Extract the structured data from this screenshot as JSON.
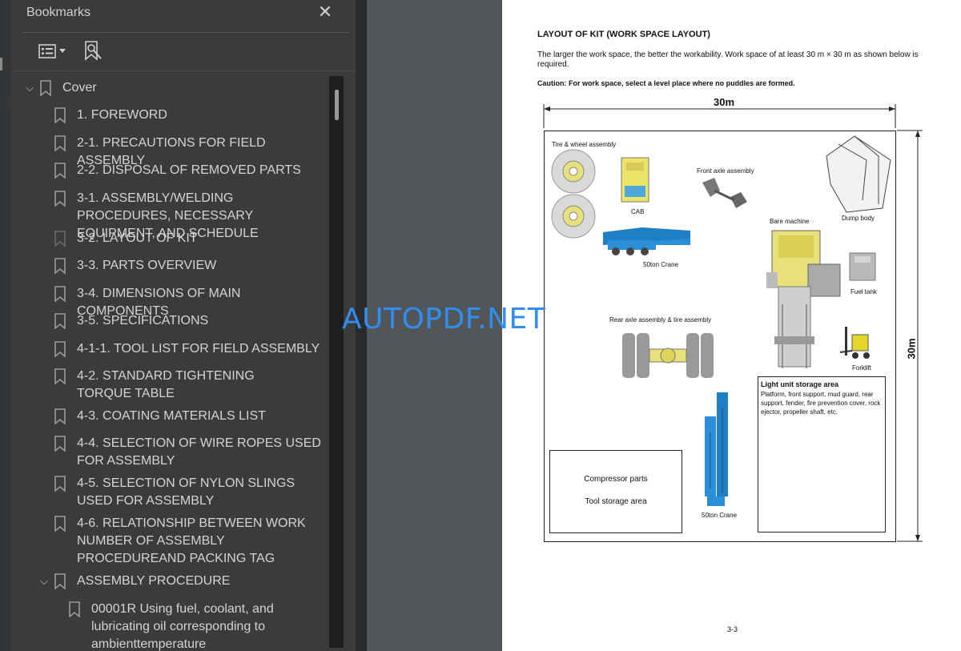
{
  "panel": {
    "title": "Bookmarks",
    "close_glyph": "✕"
  },
  "toolbar": {
    "options_icon": "list-options-icon",
    "find_icon": "bookmark-find-icon"
  },
  "bookmarks": [
    {
      "label": "Cover",
      "level": 0,
      "expanded": true
    },
    {
      "label": "1. FOREWORD",
      "level": 1
    },
    {
      "label": "2-1. PRECAUTIONS FOR FIELD ASSEMBLY",
      "level": 1
    },
    {
      "label": "2-2. DISPOSAL OF REMOVED PARTS",
      "level": 1
    },
    {
      "label": "3-1. ASSEMBLY/WELDING PROCEDURES, NECESSARY EQUIPMENT, AND SCHEDULE",
      "level": 1
    },
    {
      "label": "3-2. LAYOUT OF KIT",
      "level": 1,
      "selected": true
    },
    {
      "label": "3-3. PARTS OVERVIEW",
      "level": 1
    },
    {
      "label": "3-4. DIMENSIONS OF MAIN COMPONENTS",
      "level": 1
    },
    {
      "label": "3-5. SPECIFICATIONS",
      "level": 1
    },
    {
      "label": "4-1-1. TOOL LIST FOR FIELD ASSEMBLY",
      "level": 1
    },
    {
      "label": "4-2. STANDARD TIGHTENING TORQUE TABLE",
      "level": 1
    },
    {
      "label": "4-3. COATING MATERIALS LIST",
      "level": 1
    },
    {
      "label": "4-4. SELECTION OF WIRE ROPES USED FOR ASSEMBLY",
      "level": 1
    },
    {
      "label": "4-5. SELECTION OF NYLON SLINGS USED FOR ASSEMBLY",
      "level": 1
    },
    {
      "label": "4-6. RELATIONSHIP BETWEEN WORK NUMBER OF ASSEMBLY PROCEDUREAND PACKING TAG",
      "level": 1
    },
    {
      "label": "ASSEMBLY PROCEDURE",
      "level": 1,
      "expanded": true
    },
    {
      "label": "00001R Using fuel, coolant, and lubricating oil corresponding to ambienttemperature",
      "level": 2
    }
  ],
  "document": {
    "heading": "LAYOUT OF KIT (WORK SPACE LAYOUT)",
    "paragraph": "The larger the work space, the better the workability. Work space of at least 30 m × 30 m as shown below is required.",
    "caution": "Caution: For work space, select a level place where no puddles are formed.",
    "dim_top": "30m",
    "dim_right": "30m",
    "labels": {
      "tire_wheel": "Tire & wheel assembly",
      "cab": "CAB",
      "front_axle": "Front axle assembly",
      "dump_body": "Dump body",
      "crane_50_a": "50ton Crane",
      "bare_machine": "Bare machine",
      "fuel_tank": "Fuel tank",
      "rear_axle": "Rear axle assembly & tire assembly",
      "forklift": "Forklift",
      "crane_50_b": "50ton Crane"
    },
    "light_unit": {
      "title": "Light unit storage area",
      "text": "Platform, front support, mud guard, rear support, fender, fire prevention cover, rock ejector, propeller shaft, etc."
    },
    "compressor": {
      "line1": "Compressor parts",
      "line2": "Tool storage area"
    },
    "page_number": "3-3"
  },
  "watermark": "AUTOPDF.NET",
  "colors": {
    "panel_bg": "#3b3b3b",
    "viewer_bg": "#525659",
    "crane_blue": "#2a8fd6",
    "machine_yellow": "#e8e07a"
  }
}
